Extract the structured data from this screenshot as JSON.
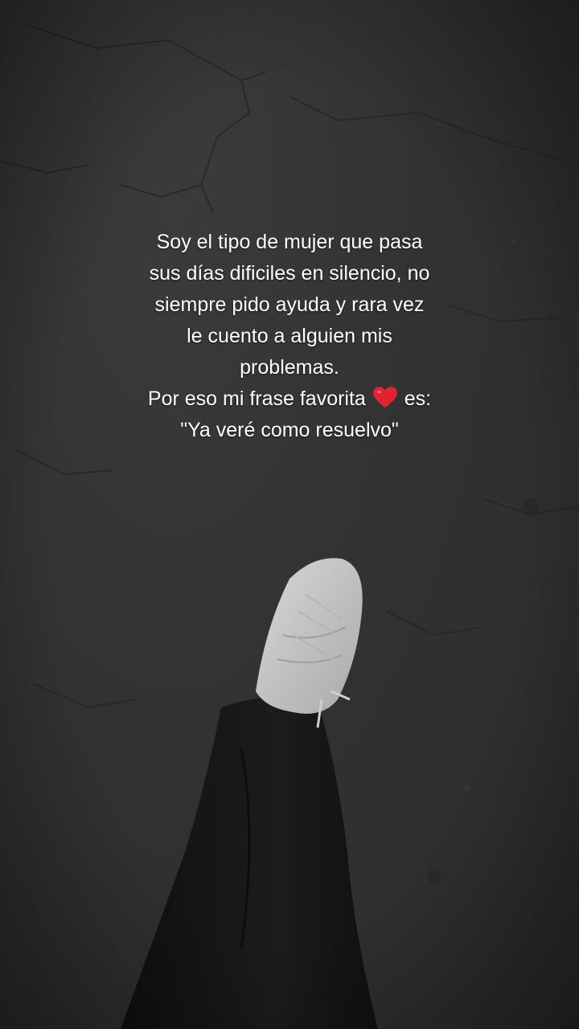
{
  "caption": {
    "lines": [
      "Soy el tipo de mujer que pasa",
      "sus días dificiles en silencio, no",
      "siempre pido ayuda y rara vez",
      "le cuento a alguien mis",
      "problemas."
    ],
    "line6_before": "Por eso mi frase favorita",
    "line6_after": "es:",
    "line7": "\"Ya veré como resuelvo\"",
    "heart_icon": "red-heart-icon",
    "heart_color": "#e0232e"
  },
  "photo": {
    "subject": "white sneaker and black pants walking on gray concrete",
    "colors": {
      "ground": "#333333",
      "sneaker": "#c9c9c9",
      "pants": "#151515"
    }
  }
}
